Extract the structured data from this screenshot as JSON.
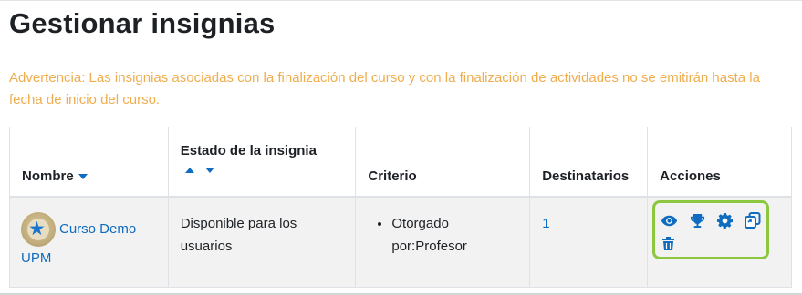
{
  "page": {
    "title": "Gestionar insignias",
    "warning": "Advertencia: Las insignias asociadas con la finalización del curso y con la finalización de actividades no se emitirán hasta la fecha de inicio del curso."
  },
  "table": {
    "headers": {
      "name": "Nombre",
      "status": "Estado de la insignia",
      "criteria": "Criterio",
      "recipients": "Destinatarios",
      "actions": "Acciones"
    },
    "rows": [
      {
        "badge_name": "Curso Demo UPM",
        "status": "Disponible para los usuarios",
        "criteria": "Otorgado por:Profesor",
        "recipients": "1",
        "actions": [
          "view-icon",
          "trophy-icon",
          "gear-icon",
          "duplicate-icon",
          "trash-icon"
        ]
      }
    ]
  },
  "colors": {
    "link": "#0f6cbf",
    "warning": "#f0ad4e",
    "highlight": "#8dc63f"
  }
}
